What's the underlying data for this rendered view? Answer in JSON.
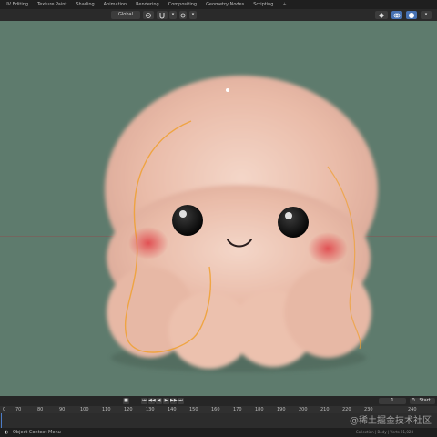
{
  "workspace_tabs": [
    "UV Editing",
    "Texture Paint",
    "Shading",
    "Animation",
    "Rendering",
    "Compositing",
    "Geometry Nodes",
    "Scripting",
    "+"
  ],
  "header": {
    "orientation": "Global",
    "pivot_icon": "pivot-icon",
    "snap_icon": "snap-magnet-icon",
    "proportional_icon": "proportional-edit-icon",
    "overlay_icon": "overlay-icon",
    "shading_icon": "viewport-shading-icon"
  },
  "viewport": {
    "background_color": "#5e7b6d",
    "subject": "fluffy pink plush creature with black eyes"
  },
  "timeline": {
    "current_frame": "1",
    "start_label": "Start",
    "ticks": [
      "0",
      "70",
      "80",
      "90",
      "100",
      "110",
      "120",
      "130",
      "140",
      "150",
      "160",
      "170",
      "180",
      "190",
      "200",
      "210",
      "220",
      "230",
      "240"
    ]
  },
  "status": {
    "left": "Object Context Menu",
    "right": "Collection | Body | Verts 21,028"
  },
  "watermark": "@稀土掘金技术社区"
}
